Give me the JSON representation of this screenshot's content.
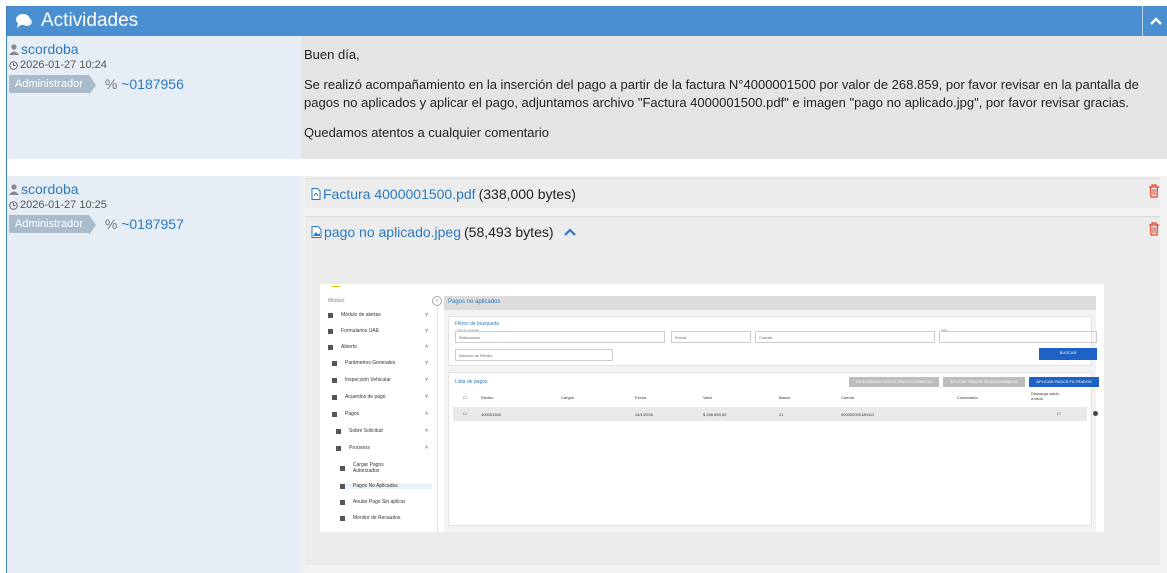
{
  "header": {
    "title": "Actividades",
    "icon": "comments-icon",
    "collapse_icon": "chevron-up-icon"
  },
  "entries": [
    {
      "user": "scordoba",
      "date": "2026-01-27 10:24",
      "role": "Administrador",
      "ticket": "~0187956",
      "paragraphs": [
        "Buen día,",
        "Se realizó acompañamiento en la inserción del pago a partir de la factura N°4000001500 por valor de 268.859, por favor revisar en la pantalla de pagos no aplicados y aplicar el pago, adjuntamos archivo \"Factura 4000001500.pdf\" e imagen \"pago no aplicado.jpg\", por favor revisar gracias.",
        "Quedamos atentos a cualquier comentario"
      ]
    },
    {
      "user": "scordoba",
      "date": "2026-01-27 10:25",
      "role": "Administrador",
      "ticket": "~0187957",
      "attachments": [
        {
          "name": "Factura 4000001500.pdf",
          "size": "(338,000 bytes)"
        },
        {
          "name": "pago no aplicado.jpeg",
          "size": "(58,493 bytes)"
        }
      ]
    }
  ],
  "preview": {
    "sidebar_top": "Módulo",
    "sidebar": [
      "Módulo de alertas",
      "Formularios UAE",
      "Abierto",
      "Parámetros Generales",
      "Inspección Vehicular",
      "Acuerdos de pago",
      "Pagos",
      "Sobre Solicitud",
      "Procesos",
      "Cargar Pagos Autorizados",
      "Pagos No Aplicados",
      "Anular Pago Sin aplicar",
      "Monitor de Recaudos"
    ],
    "title": "Pagos no aplicados",
    "filters_title": "Filtros de búsqueda",
    "filters": {
      "type_label": "Tipo de consulta",
      "type_value": "Seleccionar",
      "date": "Fecha",
      "account": "Cuenta",
      "value_label": "Valor",
      "receipt": "Número de Recibo"
    },
    "search_button": "BUSCAR",
    "list_title": "Lista de pagos",
    "actions": [
      "DESCARGAR PAGOS SELECCIONADOS",
      "APLICAR PAGOS SELECCIONADOS",
      "APLICAR PAGOS FILTRADOS"
    ],
    "columns": [
      "Recibo",
      "Cargue",
      "Fecha",
      "Valor",
      "Banco",
      "Cuenta",
      "Comentario",
      "Descarga saldo a favor"
    ],
    "row": {
      "recibo": "400001500",
      "fecha": "14/1/2026",
      "valor": "$ 268.859,00",
      "banco": "21",
      "cuenta": "000000000180412"
    }
  }
}
